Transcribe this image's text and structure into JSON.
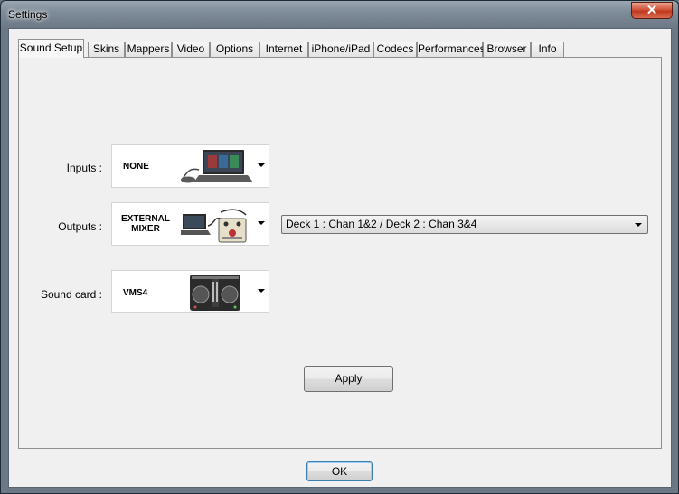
{
  "window": {
    "title": "Settings",
    "close_glyph": "✕"
  },
  "tabs": [
    {
      "label": "Sound Setup",
      "active": true
    },
    {
      "label": "Skins"
    },
    {
      "label": "Mappers"
    },
    {
      "label": "Video"
    },
    {
      "label": "Options"
    },
    {
      "label": "Internet"
    },
    {
      "label": "iPhone/iPad"
    },
    {
      "label": "Codecs"
    },
    {
      "label": "Performances"
    },
    {
      "label": "Browser"
    },
    {
      "label": "Info"
    }
  ],
  "sound_setup": {
    "inputs": {
      "label": "Inputs :",
      "value": "NONE",
      "icon": "laptop-with-mic-icon"
    },
    "outputs": {
      "label": "Outputs :",
      "value_line1": "EXTERNAL",
      "value_line2": "MIXER",
      "icon": "laptop-mixer-icon"
    },
    "sound_card": {
      "label": "Sound card :",
      "value": "VMS4",
      "icon": "dj-controller-icon"
    },
    "routing": {
      "value": "Deck 1 : Chan 1&2 / Deck 2 : Chan 3&4"
    },
    "apply_label": "Apply"
  },
  "footer": {
    "ok_label": "OK"
  }
}
